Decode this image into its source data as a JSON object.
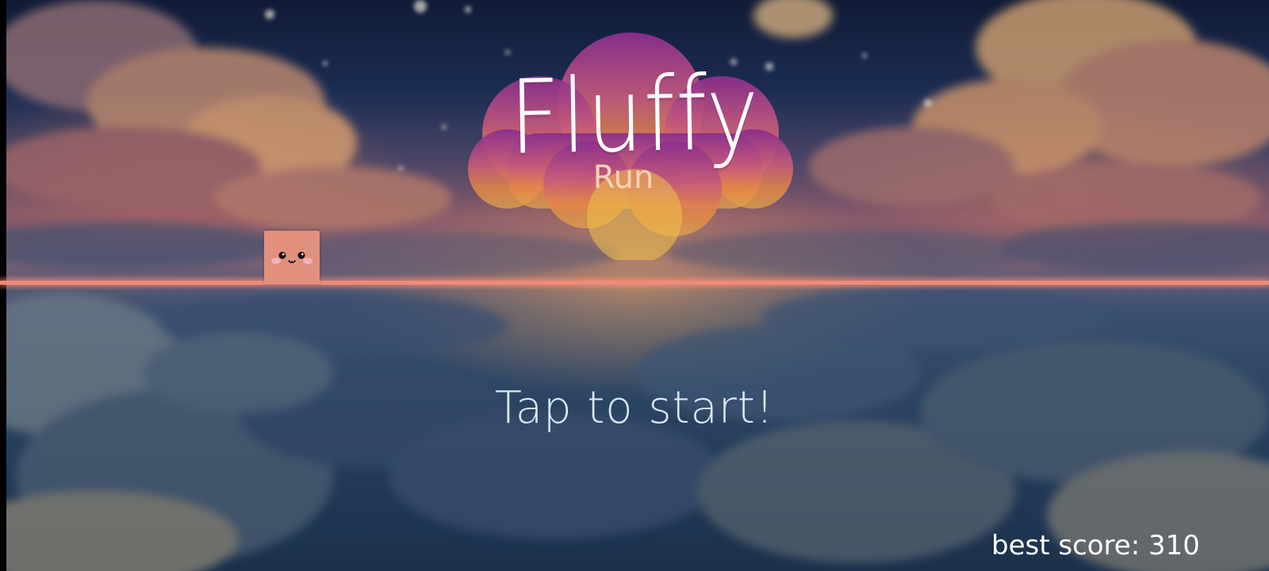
{
  "game": {
    "title": "Fluffy",
    "subtitle": "Run",
    "prompt": "Tap to start!",
    "best_score_label": "best score:",
    "best_score_value": "310"
  },
  "colors": {
    "ground_line": "#f08a78",
    "player": "#e2907e",
    "logo_gradient": [
      "#8a2e8e",
      "#c65a7a",
      "#e58845",
      "#e2a34a"
    ],
    "prompt_text": "#dce8f2"
  },
  "icons": {
    "player": "fluffy-square-character-icon",
    "logo": "fluffy-cloud-logo-icon"
  }
}
